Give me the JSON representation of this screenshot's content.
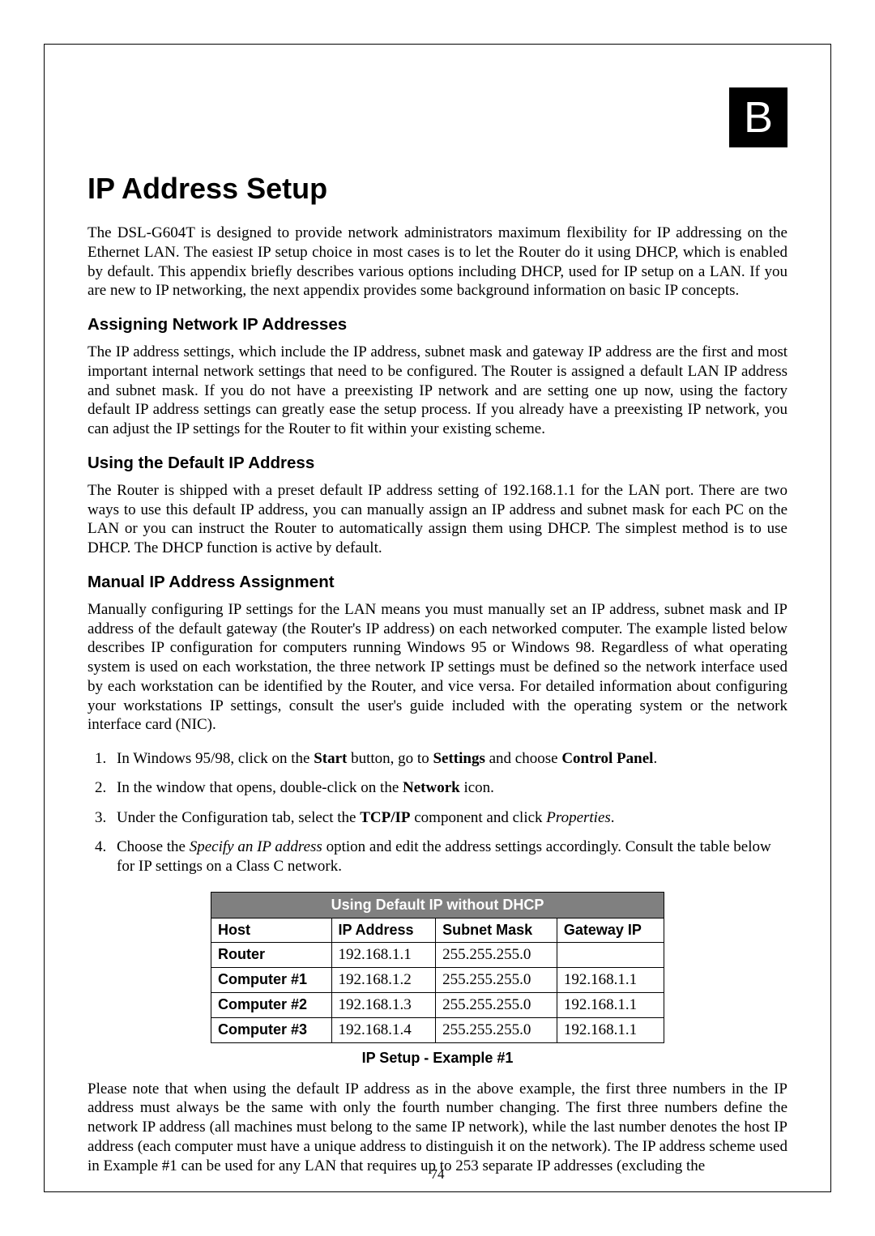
{
  "badge": "B",
  "title": "IP Address Setup",
  "intro": "The DSL-G604T is designed to provide network administrators maximum flexibility for IP addressing on the Ethernet LAN. The easiest IP setup choice in most cases is to let the Router do it using DHCP, which is enabled by default. This appendix briefly describes various options including DHCP, used for IP setup on a LAN. If you are new to IP networking, the next appendix provides some background information on basic IP concepts.",
  "sections": {
    "assigning": {
      "heading": "Assigning Network IP Addresses",
      "para": "The IP address settings, which include the IP address, subnet mask and gateway IP address are the first and most important internal network settings that need to be configured. The Router is assigned a default LAN IP address and subnet mask.  If you do not have a preexisting IP network and are setting one up now, using the factory default IP address settings can greatly ease the setup process. If you already have a preexisting IP network, you can adjust the IP settings for the Router to fit within your existing scheme."
    },
    "using_default": {
      "heading": "Using the Default IP Address",
      "para": "The Router is shipped with a preset default IP address setting of 192.168.1.1 for the LAN port.  There are two ways to use this default IP address, you can manually assign an IP address and subnet mask for each PC on the LAN or you can instruct the Router to automatically assign them using DHCP. The simplest method is to use DHCP. The DHCP function is active by default."
    },
    "manual": {
      "heading": "Manual IP Address Assignment",
      "para": "Manually configuring IP settings for the LAN means you must manually set an IP address, subnet mask and IP address of the default gateway (the Router's IP address) on each networked computer. The example listed below describes IP configuration for computers running Windows 95 or Windows 98. Regardless of what operating system is used on each workstation, the three network IP settings must be defined so the network interface used by each workstation can be identified by the Router, and vice versa. For detailed information about configuring your workstations IP settings, consult the user's guide included with the operating system or the network interface card (NIC)."
    }
  },
  "steps": {
    "s1a": "In Windows 95/98, click on the ",
    "s1b": "Start",
    "s1c": " button, go to ",
    "s1d": "Settings",
    "s1e": " and choose ",
    "s1f": "Control Panel",
    "s1g": ".",
    "s2a": "In the window that opens, double-click on the ",
    "s2b": "Network",
    "s2c": " icon.",
    "s3a": "Under the Configuration tab, select the ",
    "s3b": "TCP/IP",
    "s3c": " component and click ",
    "s3d": "Properties",
    "s3e": ".",
    "s4a": "Choose the ",
    "s4b": "Specify an IP address",
    "s4c": " option and edit the address settings accordingly. Consult the table below for IP settings on a Class C network."
  },
  "table": {
    "title": "Using Default IP without DHCP",
    "headers": {
      "host": "Host",
      "ip": "IP Address",
      "mask": "Subnet Mask",
      "gw": "Gateway IP"
    },
    "rows": [
      {
        "host": "Router",
        "ip": "192.168.1.1",
        "mask": "255.255.255.0",
        "gw": ""
      },
      {
        "host": "Computer #1",
        "ip": "192.168.1.2",
        "mask": "255.255.255.0",
        "gw": "192.168.1.1"
      },
      {
        "host": "Computer #2",
        "ip": "192.168.1.3",
        "mask": "255.255.255.0",
        "gw": "192.168.1.1"
      },
      {
        "host": "Computer #3",
        "ip": "192.168.1.4",
        "mask": "255.255.255.0",
        "gw": "192.168.1.1"
      }
    ],
    "caption": "IP Setup - Example #1"
  },
  "closing": "Please note that when using the default IP address as in the above example, the first three numbers in the IP address must always be the same with only the fourth number changing. The first three numbers define the network IP address (all machines must belong to the same IP network), while the last number denotes the host IP address (each computer must have a unique address to distinguish it on the network). The IP address scheme used in Example #1 can be used for any LAN that requires up to 253 separate IP addresses (excluding the",
  "page_number": "74"
}
